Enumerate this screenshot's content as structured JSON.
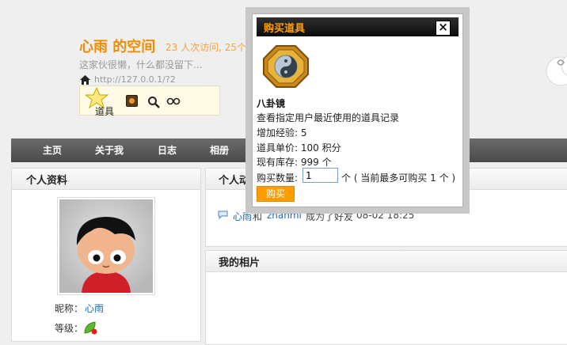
{
  "header": {
    "space_title": "心雨 的空间",
    "visit_stats": "23 人次访问, 25个",
    "description": "这家伙很懒，什么都没留下...",
    "url": "http://127.0.0.1/?2",
    "tool_label": "道具"
  },
  "nav": {
    "items": [
      "主页",
      "关于我",
      "日志",
      "相册"
    ]
  },
  "left": {
    "title": "个人资料",
    "nick_label": "昵称：",
    "nick_value": "心雨",
    "level_label": "等级："
  },
  "right": {
    "title1": "个人动态",
    "feed": {
      "user1": "心雨",
      "and": "和",
      "user2": "zhanmi",
      "action": "成为了好友",
      "time": "08-02 18:25"
    },
    "title2": "我的相片"
  },
  "modal": {
    "title": "购买道具",
    "close": "×",
    "item_name": "八卦镜",
    "item_desc": "查看指定用户最近使用的道具记录",
    "exp": "增加经验: 5",
    "price": "道具单价: 100 积分",
    "stock": "现有库存: 999 个",
    "qty_label": "购买数量:",
    "qty_value": "1",
    "qty_note": "个 ( 当前最多可购买 1 个 )",
    "buy_label": "购买"
  },
  "colors": {
    "accent": "#f08c00",
    "link": "#1a66b5",
    "nav_bg": "#555555",
    "buy_button": "#ff9c00"
  }
}
